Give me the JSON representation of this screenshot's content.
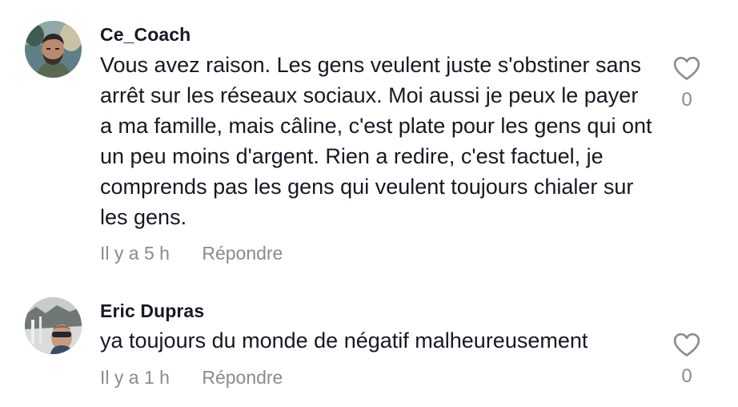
{
  "comments": [
    {
      "username": "Ce_Coach",
      "text": "Vous avez raison. Les gens veulent juste s'obstiner sans arrêt sur les réseaux sociaux. Moi aussi je peux le payer a ma famille, mais câline, c'est plate pour les gens qui ont un peu moins d'argent. Rien a redire, c'est factuel, je comprends pas les gens qui veulent toujours chialer sur les gens.",
      "time": "Il y a 5 h",
      "reply_label": "Répondre",
      "likes": "0",
      "like_icon": "heart-outline-icon"
    },
    {
      "username": "Eric Dupras",
      "text": "ya toujours du monde de négatif malheureusement",
      "time": "Il y a 1 h",
      "reply_label": "Répondre",
      "likes": "0",
      "like_icon": "heart-outline-icon"
    }
  ]
}
